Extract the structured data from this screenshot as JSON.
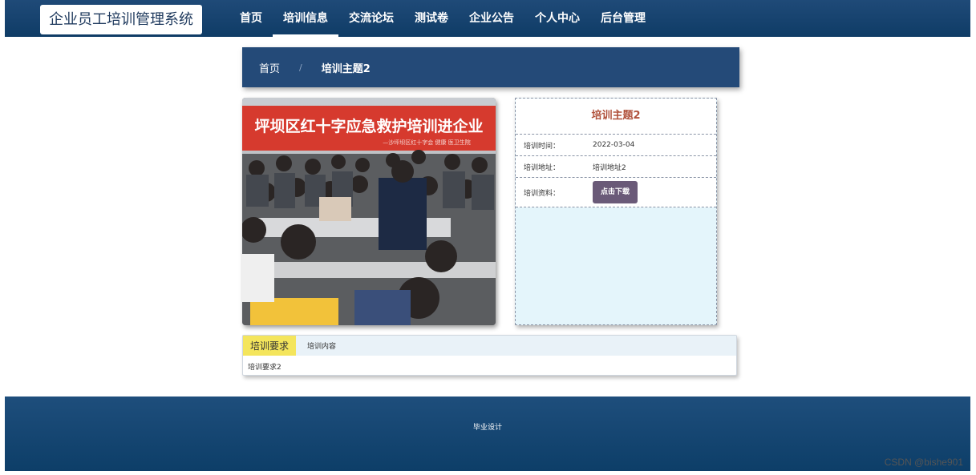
{
  "header": {
    "logo": "企业员工培训管理系统",
    "nav": [
      {
        "label": "首页",
        "active": false
      },
      {
        "label": "培训信息",
        "active": true
      },
      {
        "label": "交流论坛",
        "active": false
      },
      {
        "label": "测试卷",
        "active": false
      },
      {
        "label": "企业公告",
        "active": false
      },
      {
        "label": "个人中心",
        "active": false
      },
      {
        "label": "后台管理",
        "active": false
      }
    ]
  },
  "breadcrumb": {
    "home": "首页",
    "separator": "/",
    "current": "培训主题2"
  },
  "detail": {
    "title": "培训主题2",
    "time_label": "培训时间：",
    "time_value": "2022-03-04",
    "address_label": "培训地址：",
    "address_value": "培训地址2",
    "material_label": "培训资料：",
    "download_label": "点击下载"
  },
  "photo": {
    "banner_text": "坪坝区红十字应急救护培训进企业",
    "banner_subtext": "—沙坪坝区红十字会 健康 医卫生院"
  },
  "tabs": {
    "items": [
      {
        "label": "培训要求",
        "active": true
      },
      {
        "label": "培训内容",
        "active": false
      }
    ],
    "content": "培训要求2"
  },
  "footer": {
    "text": "毕业设计"
  },
  "watermark": "CSDN @bishe901",
  "colors": {
    "primary": "#1f4a78",
    "title_accent": "#b0503a",
    "tab_active": "#f4e55c",
    "button": "#6a5a78"
  }
}
